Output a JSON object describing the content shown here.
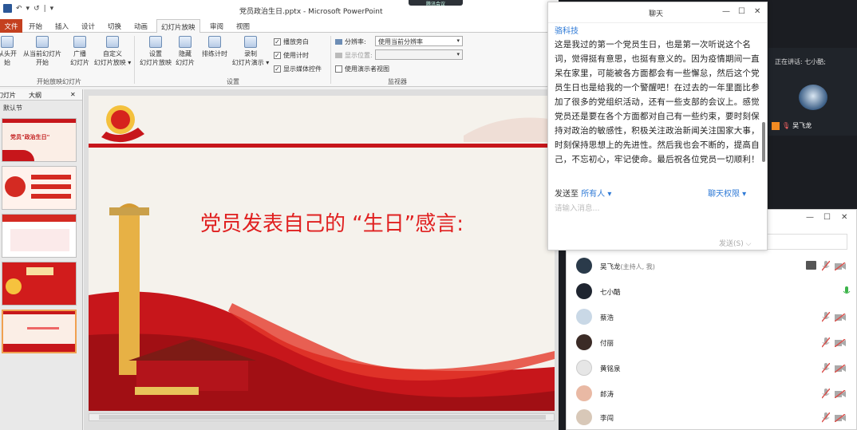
{
  "window": {
    "title": "党员政治生日.pptx - Microsoft PowerPoint",
    "qat": [
      "↶",
      "▾",
      "↺",
      "|",
      "▾"
    ]
  },
  "ribbon_tabs": [
    "文件",
    "开始",
    "插入",
    "设计",
    "切换",
    "动画",
    "幻灯片放映",
    "审阅",
    "视图"
  ],
  "ribbon": {
    "start_group": {
      "from_start": "从头开始",
      "from_current_1": "从当前幻灯片",
      "from_current_2": "开始",
      "broadcast_1": "广播",
      "broadcast_2": "幻灯片",
      "custom_1": "自定义",
      "custom_2": "幻灯片放映 ▾",
      "label": "开始放映幻灯片"
    },
    "setup_group": {
      "setup_1": "设置",
      "setup_2": "幻灯片放映",
      "hide_1": "隐藏",
      "hide_2": "幻灯片",
      "rehearse": "排练计时",
      "record_1": "录制",
      "record_2": "幻灯片演示 ▾",
      "check_narration": "播放旁白",
      "check_timing": "使用计时",
      "check_media": "显示媒体控件",
      "label": "设置"
    },
    "monitor_group": {
      "resolution_label": "分辨率:",
      "resolution_value": "使用当前分辨率",
      "show_on_label": "显示位置:",
      "presenter_view": "使用演示者视图",
      "label": "监视器"
    }
  },
  "thumb_pane": {
    "tab_slides": "幻灯片",
    "tab_outline": "大纲",
    "close": "✕",
    "section": "默认节",
    "slide1_title": "党员\"政治生日\""
  },
  "slide": {
    "title": "党员发表自己的 “生日”感言:"
  },
  "meeting_badge": "腾讯会议",
  "chat": {
    "title": "聊天",
    "sender": "骆科技",
    "message": "这是我过的第一个党员生日，也是第一次听说这个名词，觉得挺有意思，也挺有意义的。因为疫情期间一直呆在家里，可能被各方面都会有一些懈怠，然后这个党员生日也是给我的一个警醒吧！在过去的一年里面比参加了很多的党组织活动，还有一些支部的会议上。感觉党员还是要在各个方面都对自己有一些约束，要时刻保持对政治的敏感性，积极关注政治新闻关注国家大事，时刻保持思想上的先进性。然后我也会不断的，提高自己，不忘初心，牢记使命。最后祝各位党员一切顺利！",
    "send_to_label": "发送至",
    "send_to_value": "所有人 ▾",
    "permission": "聊天权限 ▾",
    "input_placeholder": "请输入消息...",
    "send_button": "发送(S)  ⌵",
    "controls": [
      "—",
      "☐",
      "✕"
    ]
  },
  "speaker": {
    "label": "正在讲话: 七小酷;",
    "self_name": "吴飞龙"
  },
  "participants": {
    "controls": [
      "—",
      "☐",
      "✕"
    ],
    "list": [
      {
        "name": "吴飞龙",
        "role": "(主持人, 我)"
      },
      {
        "name": "七小酷",
        "role": ""
      },
      {
        "name": "蔡浩",
        "role": ""
      },
      {
        "name": "付丽",
        "role": ""
      },
      {
        "name": "黄铭泉",
        "role": ""
      },
      {
        "name": "郎涛",
        "role": ""
      },
      {
        "name": "李闯",
        "role": ""
      }
    ]
  },
  "colors": {
    "accent_blue": "#2f7ad6",
    "file_tab": "#c4401f",
    "slide_red": "#e02020",
    "mic_active": "#3cb44a",
    "mic_muted": "#d9534f"
  }
}
